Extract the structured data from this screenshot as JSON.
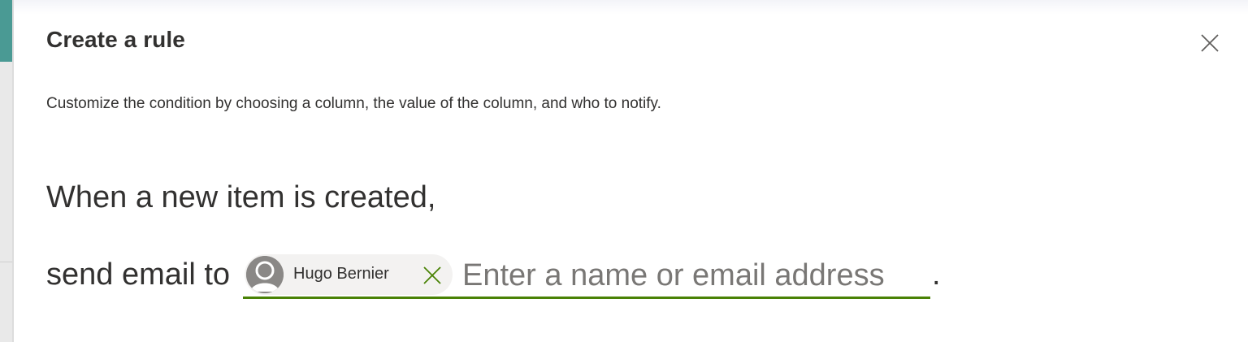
{
  "panel": {
    "title": "Create a rule",
    "description": "Customize the condition by choosing a column, the value of the column, and who to notify."
  },
  "rule": {
    "trigger_text": "When a new item is created,",
    "action_text": "send email to",
    "recipients": [
      {
        "name": "Hugo Bernier",
        "avatar": "person-icon"
      }
    ],
    "input_placeholder": "Enter a name or email address",
    "sentence_end": "."
  },
  "icons": {
    "close": "close-icon",
    "remove": "close-icon",
    "avatar": "person-icon"
  },
  "colors": {
    "accent": "#498205",
    "text": "#323130",
    "placeholder": "#797775",
    "chip_background": "#f3f2f1",
    "sidebar_accent": "#4a9a94"
  }
}
